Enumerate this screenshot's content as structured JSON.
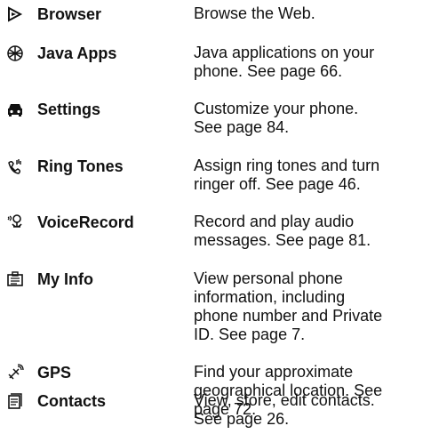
{
  "menu_items": [
    {
      "icon": "browser-icon",
      "name": "Browser",
      "description": "Browse the Web."
    },
    {
      "icon": "java-apps-icon",
      "name": "Java Apps",
      "description": "Java applications on your\nphone. See page 66."
    },
    {
      "icon": "settings-icon",
      "name": "Settings",
      "description": "Customize your phone.\nSee page 84."
    },
    {
      "icon": "ring-tones-icon",
      "name": "Ring Tones",
      "description": "Assign ring tones and turn\nringer off. See page 46."
    },
    {
      "icon": "voice-record-icon",
      "name": "VoiceRecord",
      "description": "Record and play audio\nmessages. See page 81."
    },
    {
      "icon": "my-info-icon",
      "name": "My Info",
      "description": "View personal phone\ninformation, including\nphone number and Private\nID. See page 7."
    },
    {
      "icon": "gps-icon",
      "name": "GPS",
      "description": "Find your approximate\ngeographical location. See\npage 72."
    },
    {
      "icon": "contacts-icon",
      "name": "Contacts",
      "description": "View, store, edit contacts.\nSee page 26."
    }
  ]
}
